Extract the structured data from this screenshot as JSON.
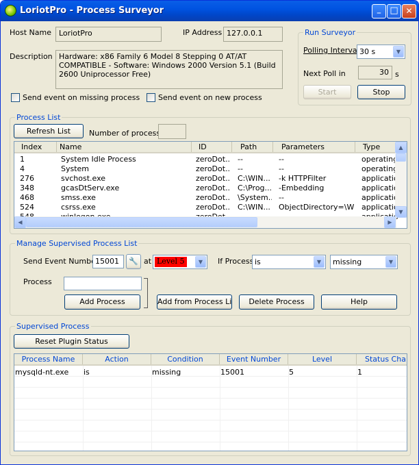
{
  "window": {
    "title": "LoriotPro - Process Surveyor",
    "min_glyph": "_",
    "max_glyph": "□",
    "close_glyph": "✕"
  },
  "host": {
    "name_label": "Host Name",
    "name_value": "LoriotPro",
    "ip_label": "IP Address",
    "ip_value": "127.0.0.1",
    "desc_label": "Description",
    "desc_value": "Hardware: x86 Family 6 Model 8 Stepping 0 AT/AT COMPATIBLE - Software: Windows 2000 Version 5.1 (Build 2600 Uniprocessor Free)"
  },
  "options": {
    "missing_label": "Send event on missing process",
    "new_label": "Send event on new process"
  },
  "run": {
    "title": "Run Surveyor",
    "polling_label": "Polling Interval",
    "polling_value": "30 s",
    "next_label": "Next Poll in",
    "next_value": "30",
    "next_unit": "s",
    "start_label": "Start",
    "stop_label": "Stop"
  },
  "process_list": {
    "title": "Process List",
    "refresh_label": "Refresh List",
    "count_label": "Number of process",
    "count_value": "",
    "columns": [
      "Index",
      "Name",
      "ID",
      "Path",
      "Parameters",
      "Type"
    ],
    "rows": [
      [
        "1",
        "System Idle Process",
        "zeroDot...",
        "--",
        "--",
        "operatingS"
      ],
      [
        "4",
        "System",
        "zeroDot...",
        "--",
        "--",
        "operatingS"
      ],
      [
        "276",
        "svchost.exe",
        "zeroDot...",
        "C:\\WIN...",
        "-k HTTPFilter",
        "application"
      ],
      [
        "348",
        "gcasDtServ.exe",
        "zeroDot...",
        "C:\\Prog...",
        "-Embedding",
        "application"
      ],
      [
        "468",
        "smss.exe",
        "zeroDot...",
        "\\System...",
        "--",
        "application"
      ],
      [
        "524",
        "csrss.exe",
        "zeroDot...",
        "C:\\WIN...",
        "ObjectDirectory=\\Wi...",
        "application"
      ],
      [
        "548",
        "winlogon.exe",
        "zeroDot...",
        "",
        "",
        "application"
      ]
    ]
  },
  "manage": {
    "title": "Manage Supervised Process List",
    "send_label": "Send Event Number",
    "event_value": "15001",
    "at_label": "at",
    "level_value": "Level 5",
    "if_label": "If Process",
    "cond_value": "is",
    "state_value": "missing",
    "process_label": "Process",
    "process_value": "",
    "add_label": "Add Process",
    "add_from_label": "Add from Process List",
    "delete_label": "Delete Process",
    "help_label": "Help"
  },
  "supervised": {
    "title": "Supervised Process",
    "reset_label": "Reset Plugin Status",
    "columns": [
      "Process Name",
      "Action",
      "Condition",
      "Event Number",
      "Level",
      "Status Change"
    ],
    "rows": [
      [
        "mysqld-nt.exe",
        "is",
        "missing",
        "15001",
        "5",
        "1"
      ]
    ]
  },
  "colors": {
    "title_blue": "#0054e3",
    "group_title": "#0046d5",
    "level_red": "#ff0000"
  }
}
